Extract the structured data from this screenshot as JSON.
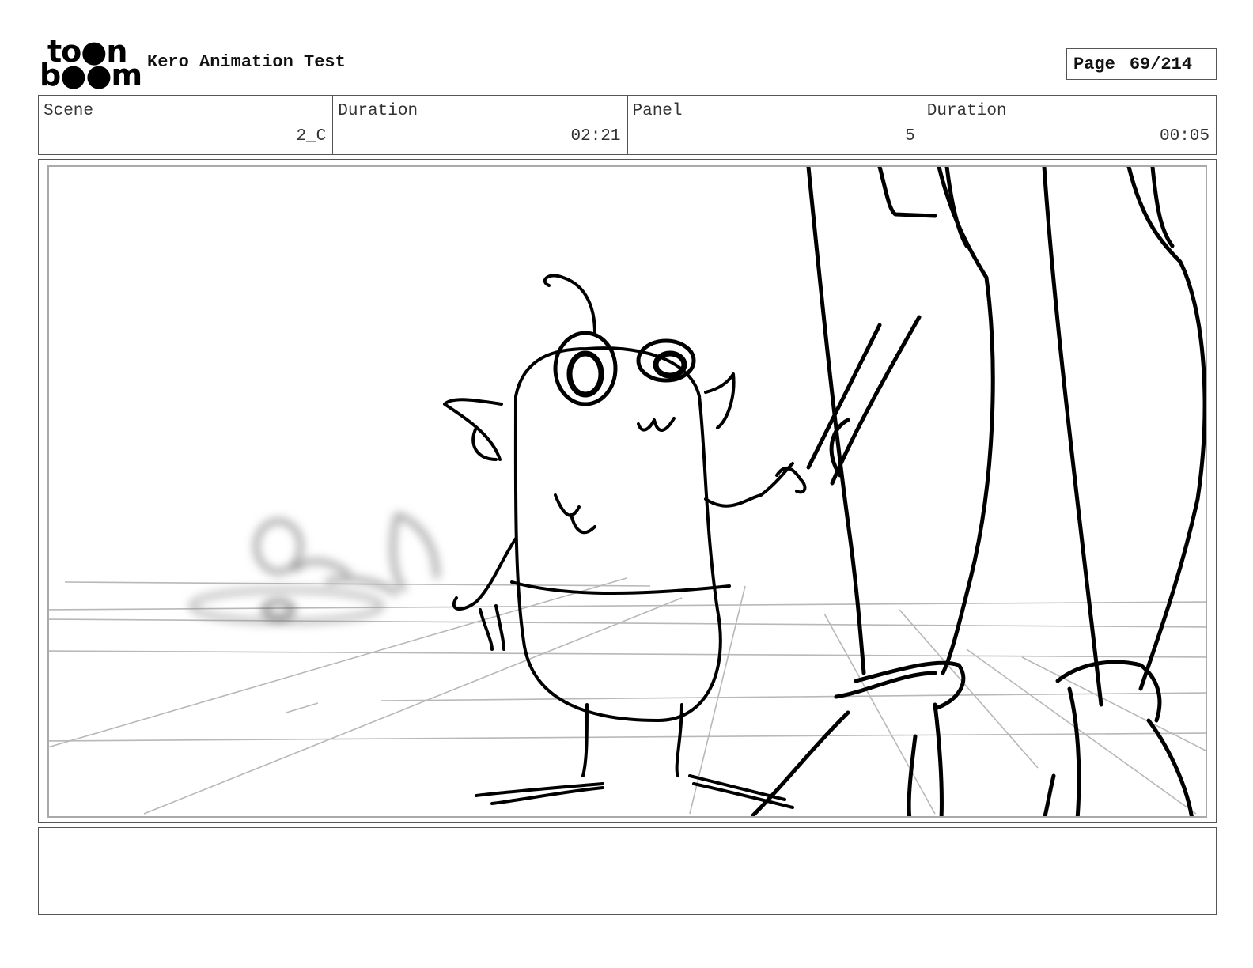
{
  "header": {
    "logo_line1": "to●n",
    "logo_line2": "b●●m",
    "title": "Kero Animation Test",
    "page_label": "Page",
    "page_value": "69/214"
  },
  "info": [
    {
      "label": "Scene",
      "value": "2_C"
    },
    {
      "label": "Duration",
      "value": "02:21"
    },
    {
      "label": "Panel",
      "value": "5"
    },
    {
      "label": "Duration",
      "value": "00:05"
    }
  ],
  "notes": ""
}
